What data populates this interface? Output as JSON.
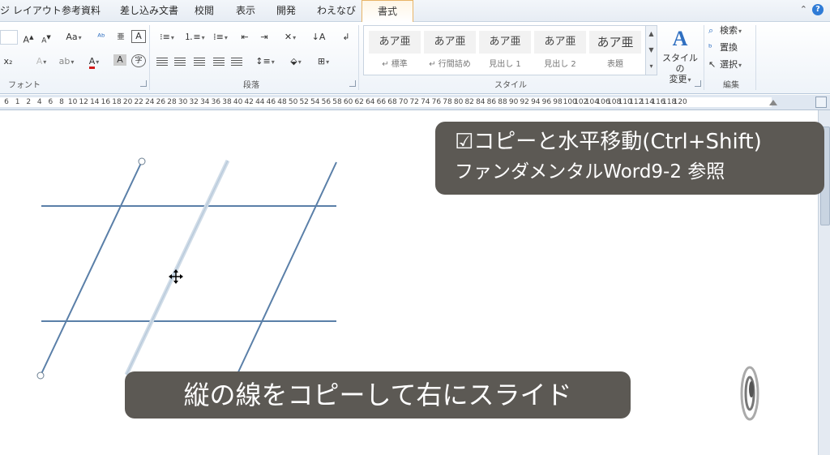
{
  "tabs": [
    {
      "label": "ジ レイアウト",
      "active": false
    },
    {
      "label": "参考資料",
      "active": false
    },
    {
      "label": "差し込み文書",
      "active": false
    },
    {
      "label": "校閲",
      "active": false
    },
    {
      "label": "表示",
      "active": false
    },
    {
      "label": "開発",
      "active": false
    },
    {
      "label": "わえなび",
      "active": false
    },
    {
      "label": "書式",
      "active": true
    }
  ],
  "ribbon": {
    "font_group_label": "フォント",
    "paragraph_group_label": "段落",
    "styles_group_label": "スタイル",
    "editing_group_label": "編集",
    "font_color_letter": "A",
    "styles": [
      {
        "preview": "あア亜",
        "name": "↵ 標準"
      },
      {
        "preview": "あア亜",
        "name": "↵ 行間詰め"
      },
      {
        "preview": "あア亜",
        "name": "見出し 1"
      },
      {
        "preview": "あア亜",
        "name": "見出し 2"
      },
      {
        "preview": "あア亜",
        "name": "表題"
      }
    ],
    "change_styles_label_1": "スタイルの",
    "change_styles_label_2": "変更",
    "find_label": "検索",
    "replace_label": "置換",
    "select_label": "選択"
  },
  "ruler": {
    "numbers": [
      "6",
      "1",
      "2",
      "4",
      "6",
      "8",
      "10",
      "12",
      "14",
      "16",
      "18",
      "20",
      "22",
      "24",
      "26",
      "28",
      "30",
      "32",
      "34",
      "36",
      "38",
      "40",
      "42",
      "44",
      "46",
      "48",
      "50",
      "52",
      "54",
      "56",
      "58",
      "60",
      "62",
      "64",
      "66",
      "68",
      "70",
      "72",
      "74",
      "76",
      "78",
      "80",
      "82",
      "84",
      "86",
      "88",
      "90",
      "92",
      "94",
      "96",
      "98",
      "100",
      "102",
      "104",
      "106",
      "108",
      "110",
      "112",
      "114",
      "116",
      "118",
      "120"
    ]
  },
  "captions": {
    "top_line1": "☑コピーと水平移動(Ctrl+Shift)",
    "top_line2": "ファンダメンタルWord9-2 参照",
    "bottom": "縦の線をコピーして右にスライド"
  },
  "colors": {
    "line": "#5a7fa8",
    "caption_bg": "#5c5954",
    "active_tab_border": "#e8b568"
  }
}
